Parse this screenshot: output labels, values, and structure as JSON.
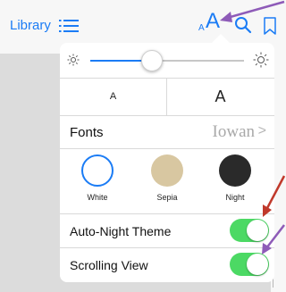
{
  "toolbar": {
    "library_label": "Library",
    "font_small_glyph": "A",
    "font_large_glyph": "A",
    "icons": [
      "list-icon",
      "font-size-icon",
      "search-icon",
      "bookmark-icon"
    ]
  },
  "panel": {
    "brightness": {
      "level": 0.4,
      "icons": [
        "sun-small-icon",
        "sun-large-icon"
      ]
    },
    "text_size": {
      "smaller_label": "A",
      "larger_label": "A"
    },
    "fonts": {
      "label": "Fonts",
      "value": "Iowan",
      "chevron": ">"
    },
    "themes": [
      {
        "label": "White",
        "color": "#ffffff"
      },
      {
        "label": "Sepia",
        "color": "#d8c7a1"
      },
      {
        "label": "Night",
        "color": "#2a2a2a"
      }
    ],
    "auto_night": {
      "label": "Auto-Night Theme",
      "on": true
    },
    "scrolling": {
      "label": "Scrolling View",
      "on": true
    }
  },
  "colors": {
    "accent": "#1b7cf5",
    "switch_on": "#4cd964",
    "annotation_arrow_purple": "#8e5bb8",
    "annotation_arrow_red": "#c0392b"
  }
}
